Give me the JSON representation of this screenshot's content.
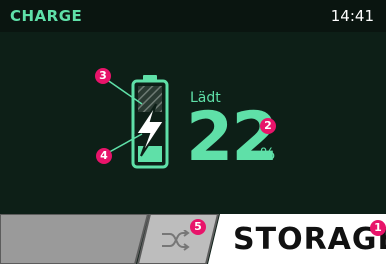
{
  "header": {
    "title": "CHARGE",
    "time": "14:41"
  },
  "battery": {
    "status_label": "Lädt",
    "level": 22,
    "unit": "%"
  },
  "bottom": {
    "mode_label": "STORAGE",
    "mode_icon": "shuffle-icon"
  },
  "callouts": [
    "1",
    "2",
    "3",
    "4",
    "5"
  ],
  "colors": {
    "background": "#0d1f17",
    "accent": "#5fe0a8",
    "callout": "#e8146a",
    "tab_inactive": "#9a9a9a",
    "tab_active": "#ffffff"
  }
}
